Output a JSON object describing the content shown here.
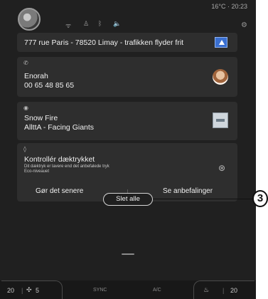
{
  "status": {
    "temp_time": "16°C  ·  20:23"
  },
  "notifications": {
    "nav": {
      "text": "777 rue Paris - 78520 Limay - trafikken flyder frit"
    },
    "call": {
      "name": "Enorah",
      "number": "00 65 48 85 65"
    },
    "music": {
      "title": "Snow Fire",
      "artist": "AllttA - Facing Giants"
    },
    "tire": {
      "title": "Kontrollér dæktrykket",
      "line1": "Dit dæktryk er lavere end det anbefalede tryk",
      "line2": "Eco-niveauet",
      "later_label": "Gør det senere",
      "recommend_label": "Se anbefalinger"
    }
  },
  "delete_all_label": "Slet alle",
  "callout_number": "3",
  "bottom": {
    "left_temp": "20",
    "fan_level": "5",
    "sync_label": "SYNC",
    "ac_label": "A/C",
    "right_temp": "20"
  },
  "icons": [
    "user-avatar",
    "wifi-icon",
    "person-icon",
    "bluetooth-icon",
    "volume-icon",
    "gear-icon",
    "phone-icon",
    "music-icon",
    "tire-pressure-icon",
    "fan-icon",
    "seat-heat-icon",
    "navigation-arrow-icon"
  ]
}
